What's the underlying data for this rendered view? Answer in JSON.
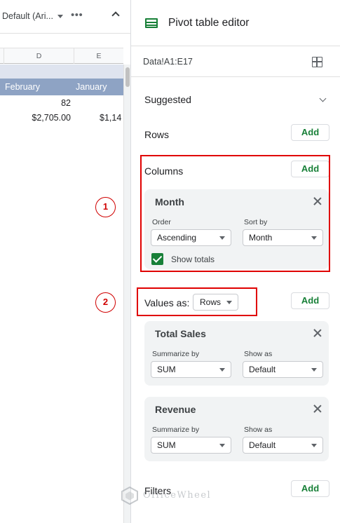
{
  "sheet": {
    "toolbar": {
      "font": "Default (Ari..."
    },
    "columns": [
      "D",
      "E"
    ],
    "header_row": [
      "February",
      "January"
    ],
    "rows": [
      [
        "82",
        ""
      ],
      [
        "$2,705.00",
        "$1,14"
      ]
    ]
  },
  "editor": {
    "title": "Pivot table editor",
    "range": "Data!A1:E17",
    "suggested_label": "Suggested",
    "rows_label": "Rows",
    "columns_label": "Columns",
    "add_label": "Add",
    "month_card": {
      "title": "Month",
      "order_label": "Order",
      "order_value": "Ascending",
      "sortby_label": "Sort by",
      "sortby_value": "Month",
      "show_totals_label": "Show totals"
    },
    "values_as_label": "Values as:",
    "values_as_value": "Rows",
    "value_cards": [
      {
        "title": "Total Sales",
        "summarize_label": "Summarize by",
        "summarize_value": "SUM",
        "showas_label": "Show as",
        "showas_value": "Default"
      },
      {
        "title": "Revenue",
        "summarize_label": "Summarize by",
        "summarize_value": "SUM",
        "showas_label": "Show as",
        "showas_value": "Default"
      }
    ],
    "filters_label": "Filters"
  },
  "annotations": {
    "step1": "1",
    "step2": "2"
  },
  "watermark": "OfficeWheel",
  "colors": {
    "accent": "#188038",
    "annotation": "#e00000",
    "header_fill": "#8ea3c4"
  }
}
